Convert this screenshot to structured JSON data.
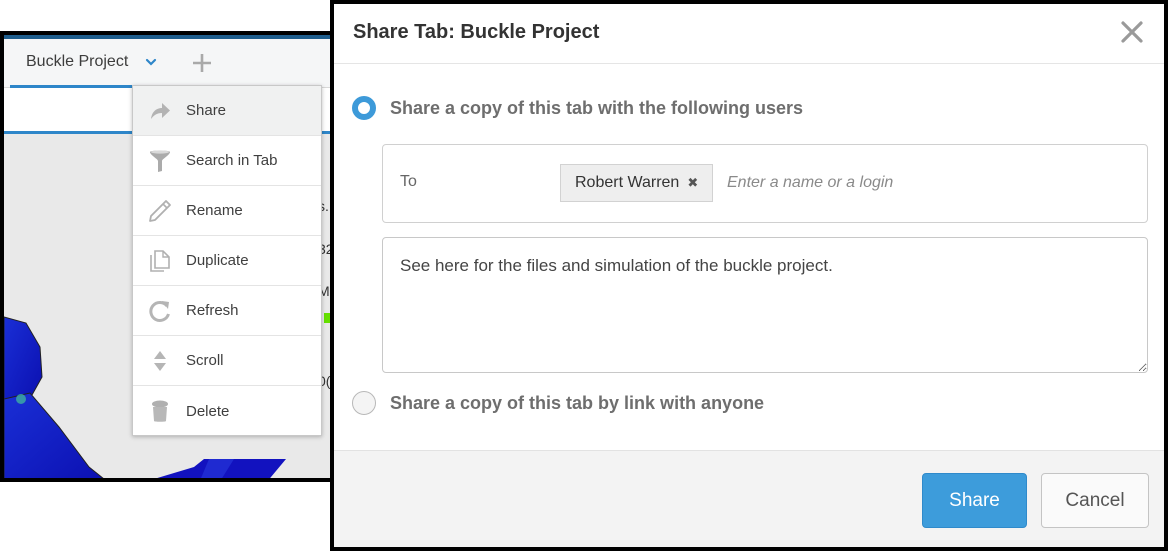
{
  "app": {
    "tab": {
      "label": "Buckle Project"
    },
    "add_tab_icon": "plus-icon",
    "side_fragments": [
      "s.",
      "32",
      "M",
      "0("
    ],
    "colors": {
      "accent": "#2e86c9",
      "model_blue": "#1414c8",
      "indicator_green": "#66e000"
    }
  },
  "context_menu": {
    "items": [
      {
        "label": "Share",
        "icon": "share-arrow-icon",
        "active": true
      },
      {
        "label": "Search in Tab",
        "icon": "funnel-icon"
      },
      {
        "label": "Rename",
        "icon": "pencil-icon"
      },
      {
        "label": "Duplicate",
        "icon": "copy-icon"
      },
      {
        "label": "Refresh",
        "icon": "refresh-icon"
      },
      {
        "label": "Scroll",
        "icon": "scroll-arrows-icon"
      },
      {
        "label": "Delete",
        "icon": "trash-icon"
      }
    ]
  },
  "dialog": {
    "title": "Share Tab: Buckle Project",
    "close_icon": "close-icon",
    "options": {
      "users": {
        "label": "Share a copy of this tab with the following users",
        "selected": true
      },
      "link": {
        "label": "Share a copy of this tab by link with anyone",
        "selected": false
      }
    },
    "to": {
      "label": "To",
      "recipients": [
        {
          "name": "Robert Warren",
          "remove_glyph": "✖"
        }
      ],
      "placeholder": "Enter a name or a login",
      "value": ""
    },
    "message": "See here for the files and simulation of the buckle project.",
    "buttons": {
      "share": "Share",
      "cancel": "Cancel"
    },
    "colors": {
      "primary": "#3d9cdb",
      "radio_checked": "#3d9ad9"
    }
  }
}
